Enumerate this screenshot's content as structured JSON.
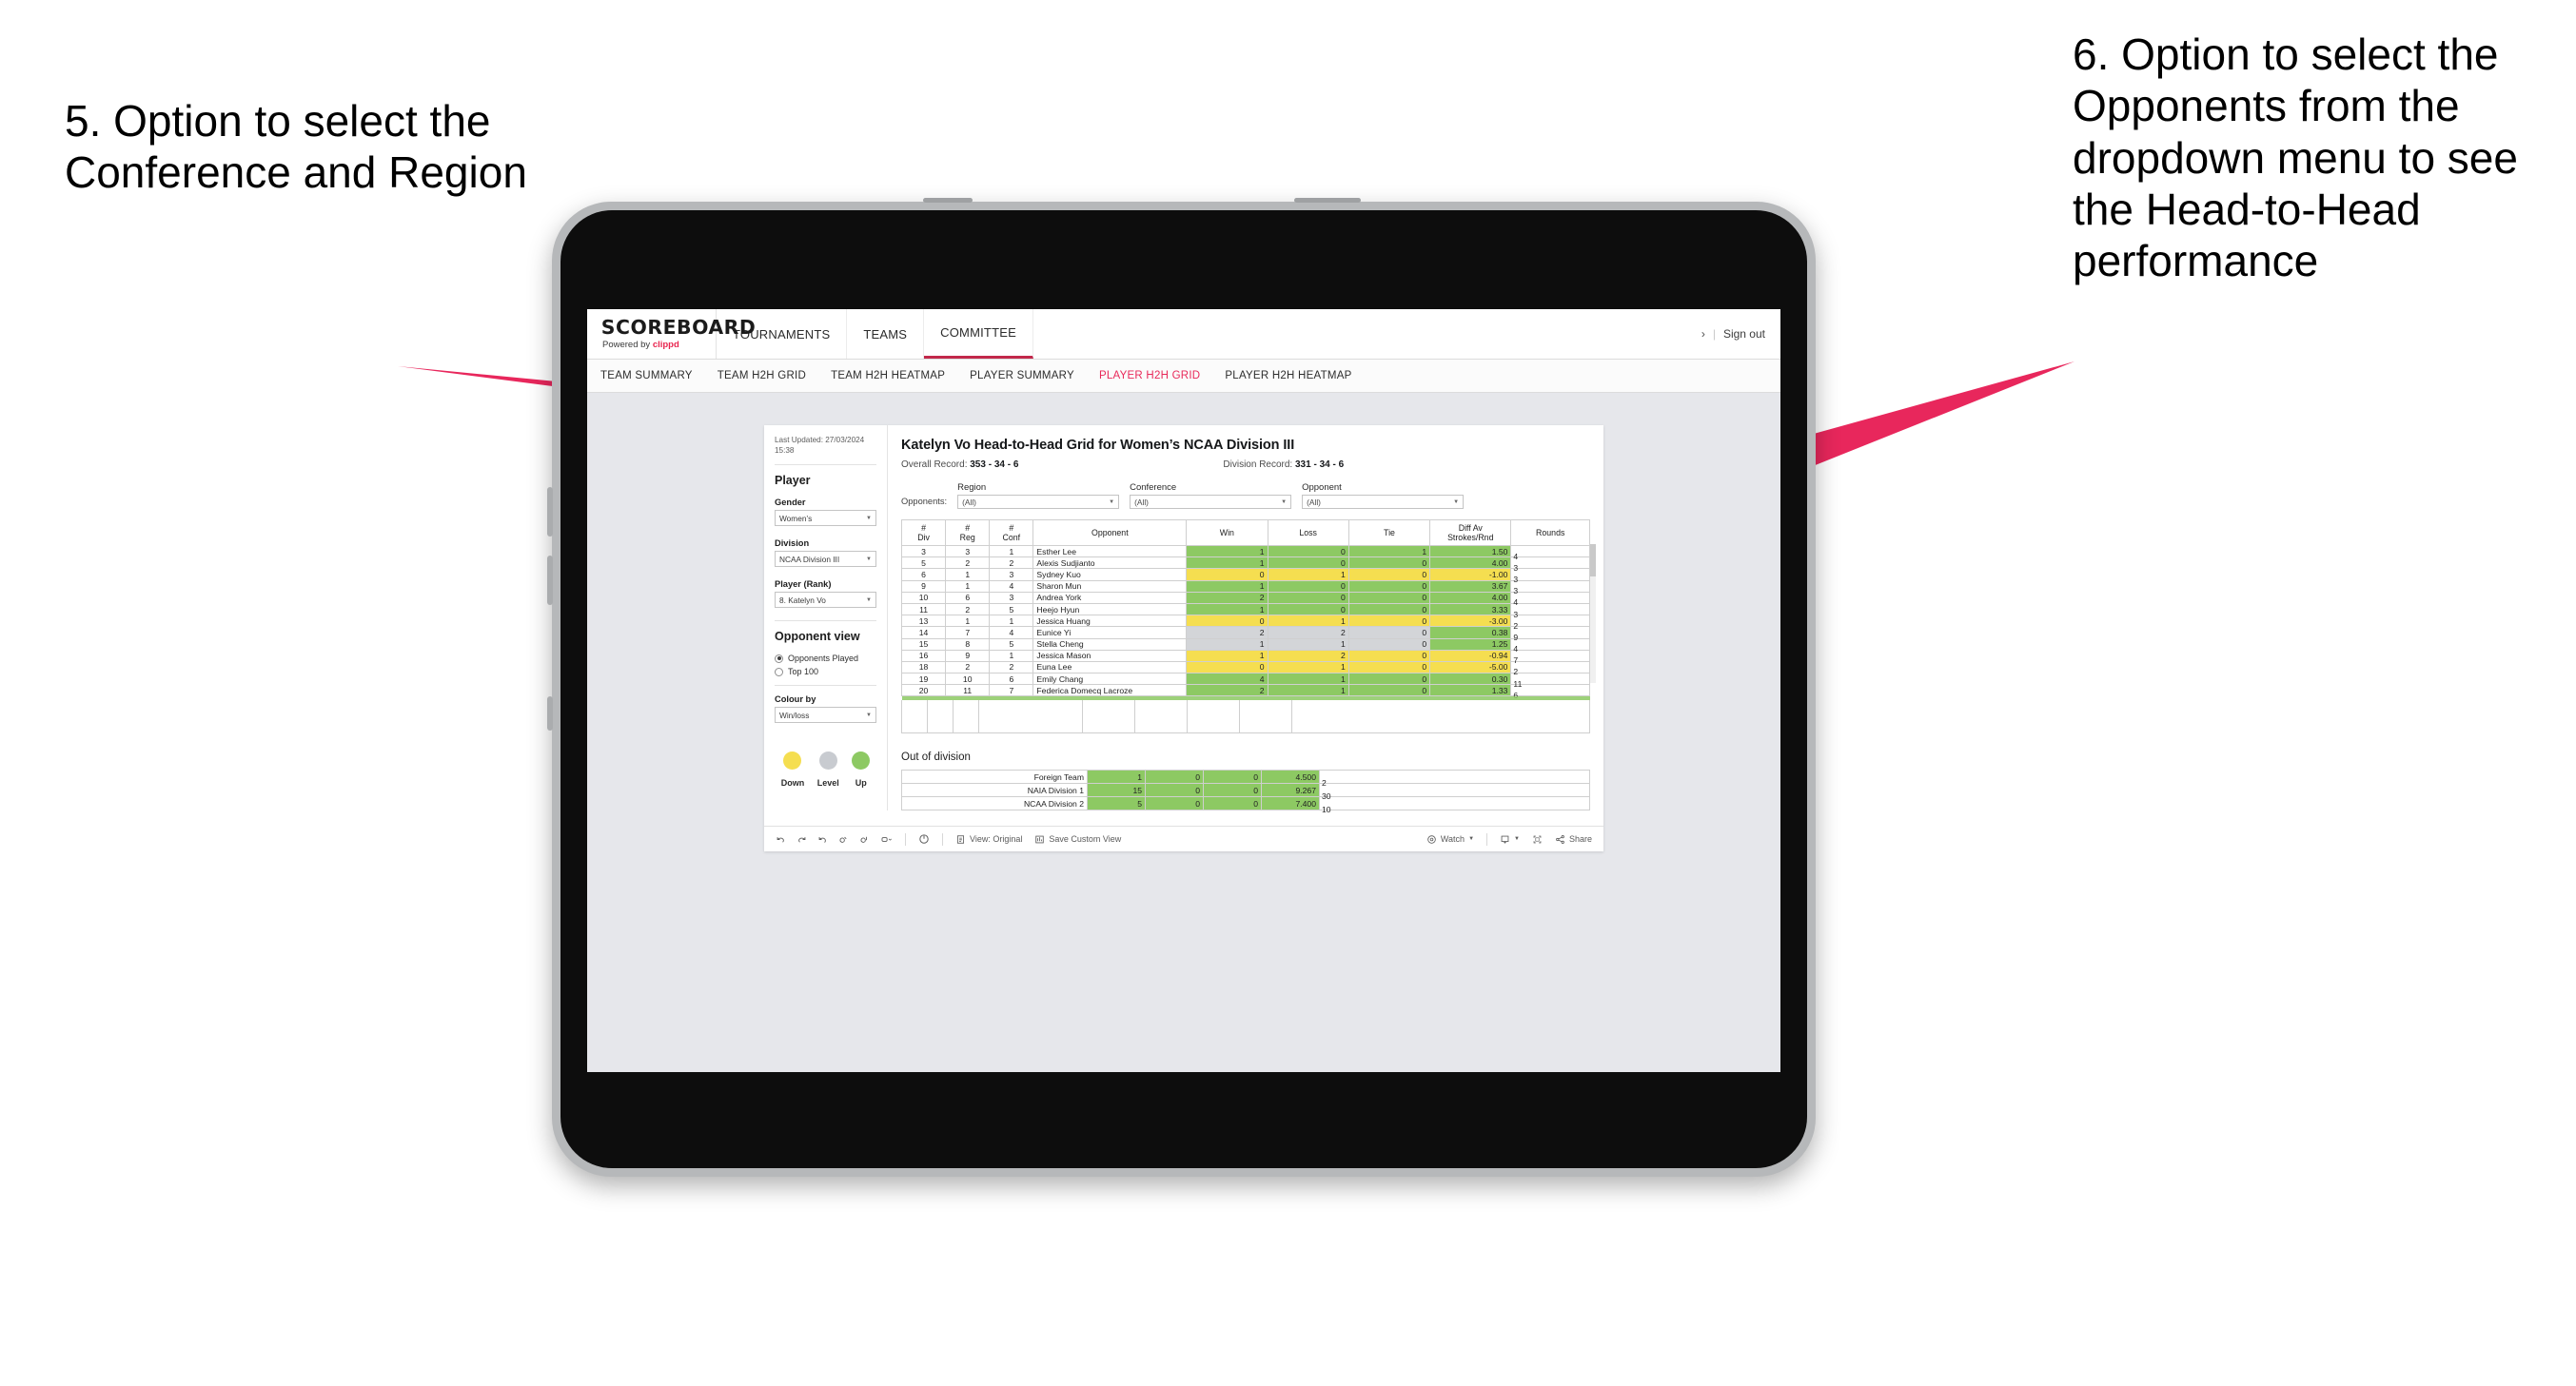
{
  "annotations": {
    "left": "5. Option to select the Conference and Region",
    "right": "6. Option to select the Opponents from the dropdown menu to see the Head-to-Head performance"
  },
  "app": {
    "brand": {
      "name": "SCOREBOARD",
      "powered_prefix": "Powered by ",
      "powered_brand": "clippd"
    },
    "topnav": [
      {
        "label": "TOURNAMENTS",
        "active": false
      },
      {
        "label": "TEAMS",
        "active": false
      },
      {
        "label": "COMMITTEE",
        "active": true
      }
    ],
    "account": {
      "chevron": "›",
      "separator": "|",
      "sign_out": "Sign out"
    },
    "subnav": [
      {
        "label": "TEAM SUMMARY",
        "active": false
      },
      {
        "label": "TEAM H2H GRID",
        "active": false
      },
      {
        "label": "TEAM H2H HEATMAP",
        "active": false
      },
      {
        "label": "PLAYER SUMMARY",
        "active": false
      },
      {
        "label": "PLAYER H2H GRID",
        "active": true
      },
      {
        "label": "PLAYER H2H HEATMAP",
        "active": false
      }
    ]
  },
  "sidebar": {
    "last_updated": "Last Updated: 27/03/2024 15:38",
    "section_player": "Player",
    "gender": {
      "label": "Gender",
      "value": "Women’s"
    },
    "division": {
      "label": "Division",
      "value": "NCAA Division III"
    },
    "player_rank": {
      "label": "Player (Rank)",
      "value": "8. Katelyn Vo"
    },
    "opponent_view": {
      "label": "Opponent view",
      "options": [
        {
          "label": "Opponents Played",
          "selected": true
        },
        {
          "label": "Top 100",
          "selected": false
        }
      ]
    },
    "colour_by": {
      "label": "Colour by",
      "value": "Win/loss"
    },
    "legend": [
      {
        "label": "Down",
        "color": "#f5de50"
      },
      {
        "label": "Level",
        "color": "#c8cbd0"
      },
      {
        "label": "Up",
        "color": "#8dc963"
      }
    ]
  },
  "main": {
    "title": "Katelyn Vo Head-to-Head Grid for Women’s NCAA Division III",
    "overall_record": {
      "label": "Overall Record:",
      "value": "353 -  34 - 6"
    },
    "division_record": {
      "label": "Division Record:",
      "value": "331 -  34 - 6"
    },
    "filters": {
      "row_label": "Opponents:",
      "items": [
        {
          "title": "Region",
          "value": "(All)"
        },
        {
          "title": "Conference",
          "value": "(All)"
        },
        {
          "title": "Opponent",
          "value": "(All)"
        }
      ]
    },
    "grid": {
      "headers": [
        "# Div",
        "# Reg",
        "# Conf",
        "Opponent",
        "Win",
        "Loss",
        "Tie",
        "Diff Av Strokes/Rnd",
        "Rounds"
      ],
      "header_lines": [
        [
          "#",
          "Div"
        ],
        [
          "#",
          "Reg"
        ],
        [
          "#",
          "Conf"
        ],
        [
          "Opponent"
        ],
        [
          "Win"
        ],
        [
          "Loss"
        ],
        [
          "Tie"
        ],
        [
          "Diff Av",
          "Strokes/Rnd"
        ],
        [
          "Rounds"
        ]
      ],
      "rounds_max": 11,
      "rows": [
        {
          "div": "3",
          "reg": "3",
          "conf": "1",
          "opponent": "Esther Lee",
          "win": "1",
          "loss": "0",
          "tie": "1",
          "diff": "1.50",
          "rounds": "4",
          "state": "up"
        },
        {
          "div": "5",
          "reg": "2",
          "conf": "2",
          "opponent": "Alexis Sudjianto",
          "win": "1",
          "loss": "0",
          "tie": "0",
          "diff": "4.00",
          "rounds": "3",
          "state": "up"
        },
        {
          "div": "6",
          "reg": "1",
          "conf": "3",
          "opponent": "Sydney Kuo",
          "win": "0",
          "loss": "1",
          "tie": "0",
          "diff": "-1.00",
          "rounds": "3",
          "state": "down"
        },
        {
          "div": "9",
          "reg": "1",
          "conf": "4",
          "opponent": "Sharon Mun",
          "win": "1",
          "loss": "0",
          "tie": "0",
          "diff": "3.67",
          "rounds": "3",
          "state": "up"
        },
        {
          "div": "10",
          "reg": "6",
          "conf": "3",
          "opponent": "Andrea York",
          "win": "2",
          "loss": "0",
          "tie": "0",
          "diff": "4.00",
          "rounds": "4",
          "state": "up"
        },
        {
          "div": "11",
          "reg": "2",
          "conf": "5",
          "opponent": "Heejo Hyun",
          "win": "1",
          "loss": "0",
          "tie": "0",
          "diff": "3.33",
          "rounds": "3",
          "state": "up"
        },
        {
          "div": "13",
          "reg": "1",
          "conf": "1",
          "opponent": "Jessica Huang",
          "win": "0",
          "loss": "1",
          "tie": "0",
          "diff": "-3.00",
          "rounds": "2",
          "state": "down"
        },
        {
          "div": "14",
          "reg": "7",
          "conf": "4",
          "opponent": "Eunice Yi",
          "win": "2",
          "loss": "2",
          "tie": "0",
          "diff": "0.38",
          "rounds": "9",
          "state": "level"
        },
        {
          "div": "15",
          "reg": "8",
          "conf": "5",
          "opponent": "Stella Cheng",
          "win": "1",
          "loss": "1",
          "tie": "0",
          "diff": "1.25",
          "rounds": "4",
          "state": "level"
        },
        {
          "div": "16",
          "reg": "9",
          "conf": "1",
          "opponent": "Jessica Mason",
          "win": "1",
          "loss": "2",
          "tie": "0",
          "diff": "-0.94",
          "rounds": "7",
          "state": "down"
        },
        {
          "div": "18",
          "reg": "2",
          "conf": "2",
          "opponent": "Euna Lee",
          "win": "0",
          "loss": "1",
          "tie": "0",
          "diff": "-5.00",
          "rounds": "2",
          "state": "down"
        },
        {
          "div": "19",
          "reg": "10",
          "conf": "6",
          "opponent": "Emily Chang",
          "win": "4",
          "loss": "1",
          "tie": "0",
          "diff": "0.30",
          "rounds": "11",
          "state": "up"
        },
        {
          "div": "20",
          "reg": "11",
          "conf": "7",
          "opponent": "Federica Domecq Lacroze",
          "win": "2",
          "loss": "1",
          "tie": "0",
          "diff": "1.33",
          "rounds": "6",
          "state": "up"
        }
      ]
    },
    "out_of_division": {
      "title": "Out of division",
      "rounds_max": 30,
      "rows": [
        {
          "name": "Foreign Team",
          "win": "1",
          "loss": "0",
          "tie": "0",
          "diff": "4.500",
          "rounds": "2",
          "state": "up"
        },
        {
          "name": "NAIA Division 1",
          "win": "15",
          "loss": "0",
          "tie": "0",
          "diff": "9.267",
          "rounds": "30",
          "state": "up"
        },
        {
          "name": "NCAA Division 2",
          "win": "5",
          "loss": "0",
          "tie": "0",
          "diff": "7.400",
          "rounds": "10",
          "state": "up"
        }
      ]
    }
  },
  "toolbar": {
    "view_label": "View: Original",
    "save_label": "Save Custom View",
    "watch_label": "Watch",
    "share_label": "Share"
  },
  "colors": {
    "up": "#8dc963",
    "down": "#f5de50",
    "level": "#d3d5d8",
    "accent": "#e8295a",
    "annotation_arrow": "#e8275c"
  }
}
